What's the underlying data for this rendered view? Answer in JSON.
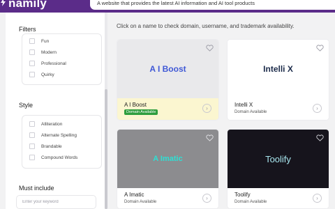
{
  "header": {
    "logo_text": "namily",
    "tagline": "A website that provides the latest AI information and AI tool products"
  },
  "sidebar": {
    "filters_title": "Filters",
    "filter_options": [
      "Fun",
      "Modern",
      "Professional",
      "Quirky"
    ],
    "style_title": "Style",
    "style_options": [
      "Alliteration",
      "Alternate Spelling",
      "Brandable",
      "Compound Words"
    ],
    "must_include_title": "Must include",
    "keyword_placeholder": "Enter your keyword"
  },
  "main": {
    "instruction": "Click on a name to check domain, username, and trademark availability.",
    "cards": [
      {
        "name": "A I Boost",
        "logo_text": "A I Boost",
        "status": "Domain Available",
        "highlighted": true
      },
      {
        "name": "Intelli X",
        "logo_text": "Intelli X",
        "status": "Domain Available",
        "highlighted": false
      },
      {
        "name": "A Imatic",
        "logo_text": "A Imatic",
        "status": "Domain Available",
        "highlighted": false
      },
      {
        "name": "Toolify",
        "logo_text": "Toolify",
        "status": "Domain Available",
        "highlighted": false
      }
    ]
  },
  "colors": {
    "brand_purple": "#5b2c89",
    "available_green": "#2e9e3e",
    "highlight_yellow": "#fbf6d0"
  },
  "icons": {
    "heart": "heart-icon",
    "arrow": "chevron-right-icon",
    "logo": "lightning-icon"
  }
}
